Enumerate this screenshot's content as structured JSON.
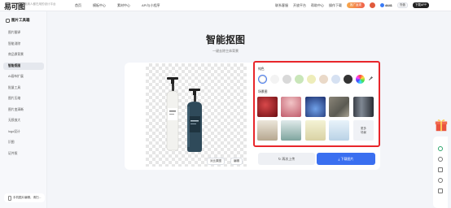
{
  "header": {
    "logo": "易可图",
    "tagline": "电商人都在用的设计平台",
    "nav": [
      "首页",
      "模板中心",
      "素材中心",
      "API与小程序"
    ],
    "right_links": [
      "联系客服",
      "开放平台",
      "帮助中心",
      "操作下载"
    ],
    "vip_label": "推广返现",
    "coins": "4441",
    "recharge": "充值",
    "app_button": "下载APP"
  },
  "sidebar": {
    "heading": "图片工具箱",
    "items": [
      "图片翻译",
      "智能消除",
      "商品换背景",
      "智能抠图",
      "AI画布扩展",
      "批量工具",
      "图片压缩",
      "图片变清晰",
      "无损放大",
      "logo设计",
      "识图",
      "证件照"
    ],
    "active_index": 3,
    "footer": "手机图片编辑，请扫..."
  },
  "main": {
    "title": "智能抠图",
    "subtitle": "一键去除主体背景"
  },
  "preview": {
    "compare_label": "对比原图",
    "edit_label": "编辑"
  },
  "panel": {
    "color_label": "纯色",
    "scene_label": "场景图",
    "more_label_1": "更多",
    "more_label_2": "场景"
  },
  "colors": [
    "#ffffff",
    "#f3f3f3",
    "#d9d9d9",
    "#c9e6b9",
    "#eeedba",
    "#ead9c8",
    "#d6e1f2",
    "#333333",
    "rainbow"
  ],
  "actions": {
    "reupload": "再次上传",
    "download": "下载图片"
  },
  "icons": [
    "eyedropper-icon",
    "gift-icon",
    "refresh-icon",
    "download-icon"
  ]
}
